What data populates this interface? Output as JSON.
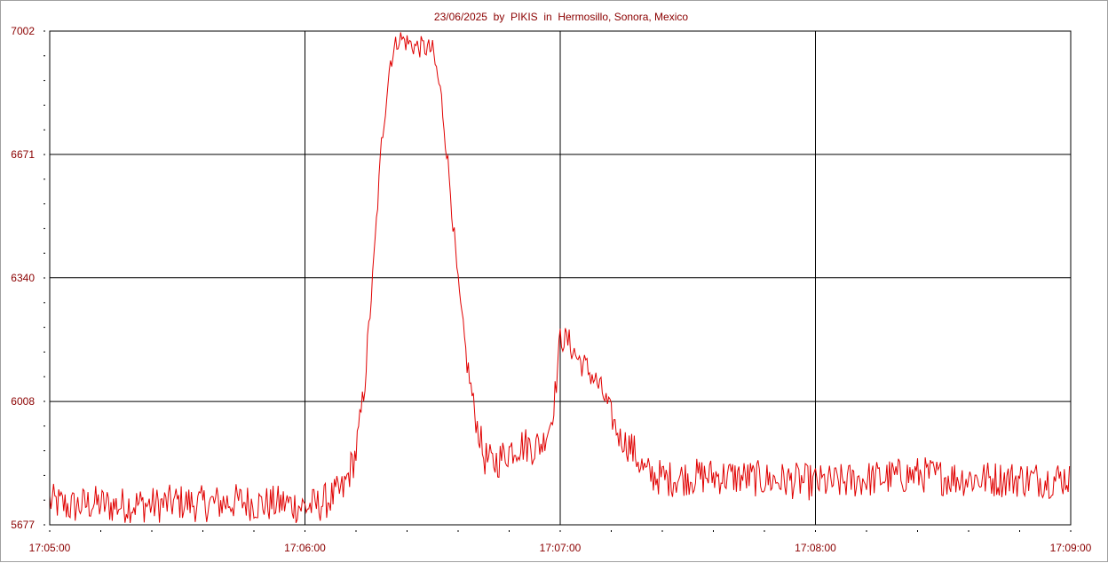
{
  "chart_data": {
    "type": "line",
    "title": "23/06/2025  by  PIKIS  in  Hermosillo, Sonora, Mexico",
    "xlabel": "",
    "ylabel": "",
    "x_range": [
      "17:05:00",
      "17:09:00"
    ],
    "xlim_seconds_of_window": [
      0,
      240
    ],
    "ylim": [
      5677,
      7002
    ],
    "y_ticks": [
      5677,
      6008,
      6340,
      6671,
      7002
    ],
    "x_ticks": [
      "17:05:00",
      "17:06:00",
      "17:07:00",
      "17:08:00",
      "17:09:00"
    ],
    "grid": true,
    "line_color": "#e00000",
    "series": [
      {
        "x": [
          "17:05:00",
          "17:05:05",
          "17:05:10",
          "17:05:15",
          "17:05:20",
          "17:05:25",
          "17:05:30",
          "17:05:35",
          "17:05:40",
          "17:05:45",
          "17:05:50",
          "17:05:55",
          "17:06:00",
          "17:06:03",
          "17:06:06",
          "17:06:09",
          "17:06:12",
          "17:06:14",
          "17:06:16",
          "17:06:18",
          "17:06:20",
          "17:06:22",
          "17:06:24",
          "17:06:26",
          "17:06:28",
          "17:06:30",
          "17:06:32",
          "17:06:34",
          "17:06:36",
          "17:06:38",
          "17:06:40",
          "17:06:42",
          "17:06:44",
          "17:06:46",
          "17:06:48",
          "17:06:50",
          "17:06:52",
          "17:06:54",
          "17:06:56",
          "17:06:58",
          "17:06:59",
          "17:07:00",
          "17:07:02",
          "17:07:04",
          "17:07:06",
          "17:07:08",
          "17:07:10",
          "17:07:12",
          "17:07:14",
          "17:07:16",
          "17:07:18",
          "17:07:20",
          "17:07:25",
          "17:07:30",
          "17:07:35",
          "17:07:40",
          "17:07:45",
          "17:07:50",
          "17:07:55",
          "17:08:00",
          "17:08:05",
          "17:08:10",
          "17:08:15",
          "17:08:20",
          "17:08:25",
          "17:08:30",
          "17:08:35",
          "17:08:40",
          "17:08:45",
          "17:08:50",
          "17:08:55",
          "17:09:00"
        ],
        "values": [
          5740,
          5725,
          5735,
          5728,
          5732,
          5730,
          5738,
          5733,
          5736,
          5740,
          5732,
          5735,
          5725,
          5730,
          5748,
          5770,
          5870,
          6050,
          6350,
          6700,
          6920,
          6985,
          6972,
          6960,
          6958,
          6950,
          6830,
          6600,
          6320,
          6120,
          5970,
          5860,
          5840,
          5855,
          5878,
          5890,
          5892,
          5885,
          5900,
          5960,
          6050,
          6180,
          6168,
          6125,
          6100,
          6070,
          6030,
          5970,
          5910,
          5895,
          5860,
          5815,
          5800,
          5805,
          5808,
          5806,
          5802,
          5797,
          5795,
          5790,
          5790,
          5798,
          5802,
          5808,
          5812,
          5805,
          5802,
          5800,
          5800,
          5800,
          5798,
          5805
        ]
      }
    ]
  }
}
